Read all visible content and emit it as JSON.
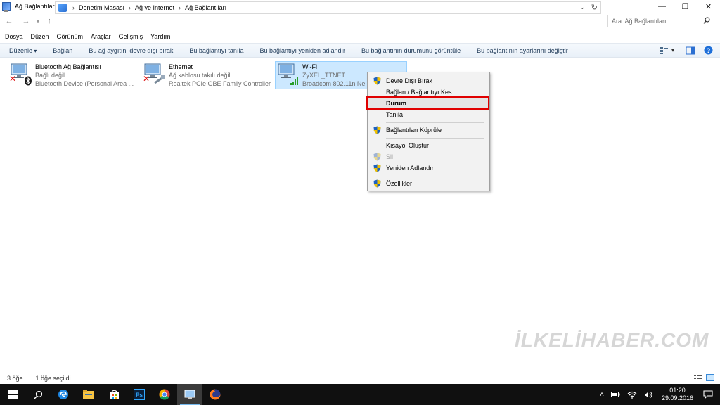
{
  "window": {
    "title": "Ağ Bağlantıları",
    "minimize": "—",
    "restore": "❐",
    "close": "✕"
  },
  "address": {
    "crumbs": [
      "Denetim Masası",
      "Ağ ve Internet",
      "Ağ Bağlantıları"
    ],
    "search_placeholder": "Ara: Ağ Bağlantıları"
  },
  "menu": [
    "Dosya",
    "Düzen",
    "Görünüm",
    "Araçlar",
    "Gelişmiş",
    "Yardım"
  ],
  "commands": [
    "Düzenle",
    "Bağlan",
    "Bu ağ aygıtını devre dışı bırak",
    "Bu bağlantıyı tanıla",
    "Bu bağlantıyı yeniden adlandır",
    "Bu bağlantının durumunu görüntüle",
    "Bu bağlantının ayarlarını değiştir"
  ],
  "connections": [
    {
      "name": "Bluetooth Ağ Bağlantısı",
      "status": "Bağlı değil",
      "device": "Bluetooth Device (Personal Area ..."
    },
    {
      "name": "Ethernet",
      "status": "Ağ kablosu takılı değil",
      "device": "Realtek PCIe GBE Family Controller"
    },
    {
      "name": "Wi-Fi",
      "status": "ZyXEL_TTNET",
      "device": "Broadcom 802.11n Ne"
    }
  ],
  "context_menu": {
    "disable": "Devre Dışı Bırak",
    "connect": "Bağlan / Bağlantıyı Kes",
    "status": "Durum",
    "diagnose": "Tanıla",
    "bridge": "Bağlantıları Köprüle",
    "shortcut": "Kısayol Oluştur",
    "delete": "Sil",
    "rename": "Yeniden Adlandır",
    "properties": "Özellikler"
  },
  "watermark": "İLKELİHABER.COM",
  "statusbar": {
    "count": "3 öğe",
    "selected": "1 öğe seçildi"
  },
  "clock": {
    "time": "01:20",
    "date": "29.09.2016"
  },
  "colors": {
    "selection": "#cce8ff",
    "highlight_border": "#e00000",
    "taskbar": "#101010"
  }
}
